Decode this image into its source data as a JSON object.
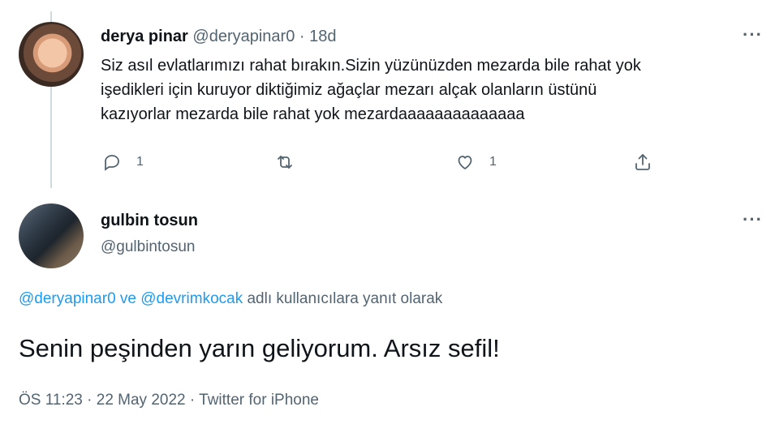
{
  "tweet1": {
    "name": "derya pinar",
    "handle": "@deryapinar0",
    "separator": "·",
    "age": "18d",
    "body_lines": [
      "Siz asıl evlatlarımızı rahat bırakın.Sizin yüzünüzden mezarda bile rahat yok",
      "işedikleri için kuruyor diktiğimiz ağaçlar mezarı alçak olanların üstünü",
      "kazıyorlar mezarda bile rahat yok mezardaaaaaaaaaaaaaa"
    ],
    "more": "···",
    "actions": {
      "reply_icon": "reply-icon",
      "reply_count": "1",
      "retweet_icon": "retweet-icon",
      "like_icon": "heart-icon",
      "like_count": "1",
      "share_icon": "share-icon"
    }
  },
  "tweet2": {
    "name": "gulbin tosun",
    "handle": "@gulbintosun",
    "more": "···",
    "reply_to": {
      "mention1": "@deryapinar0",
      "conj": " ve ",
      "mention2": "@devrimkocak",
      "suffix": " adlı kullanıcılara yanıt olarak"
    },
    "body": "Senin peşinden yarın geliyorum. Arsız sefil!",
    "meta": "ÖS 11:23 · 22 May 2022 · Twitter for iPhone"
  },
  "colors": {
    "text": "#0f1419",
    "muted": "#536471",
    "link": "#1d9bf0",
    "thread_line": "#cfd9de"
  }
}
